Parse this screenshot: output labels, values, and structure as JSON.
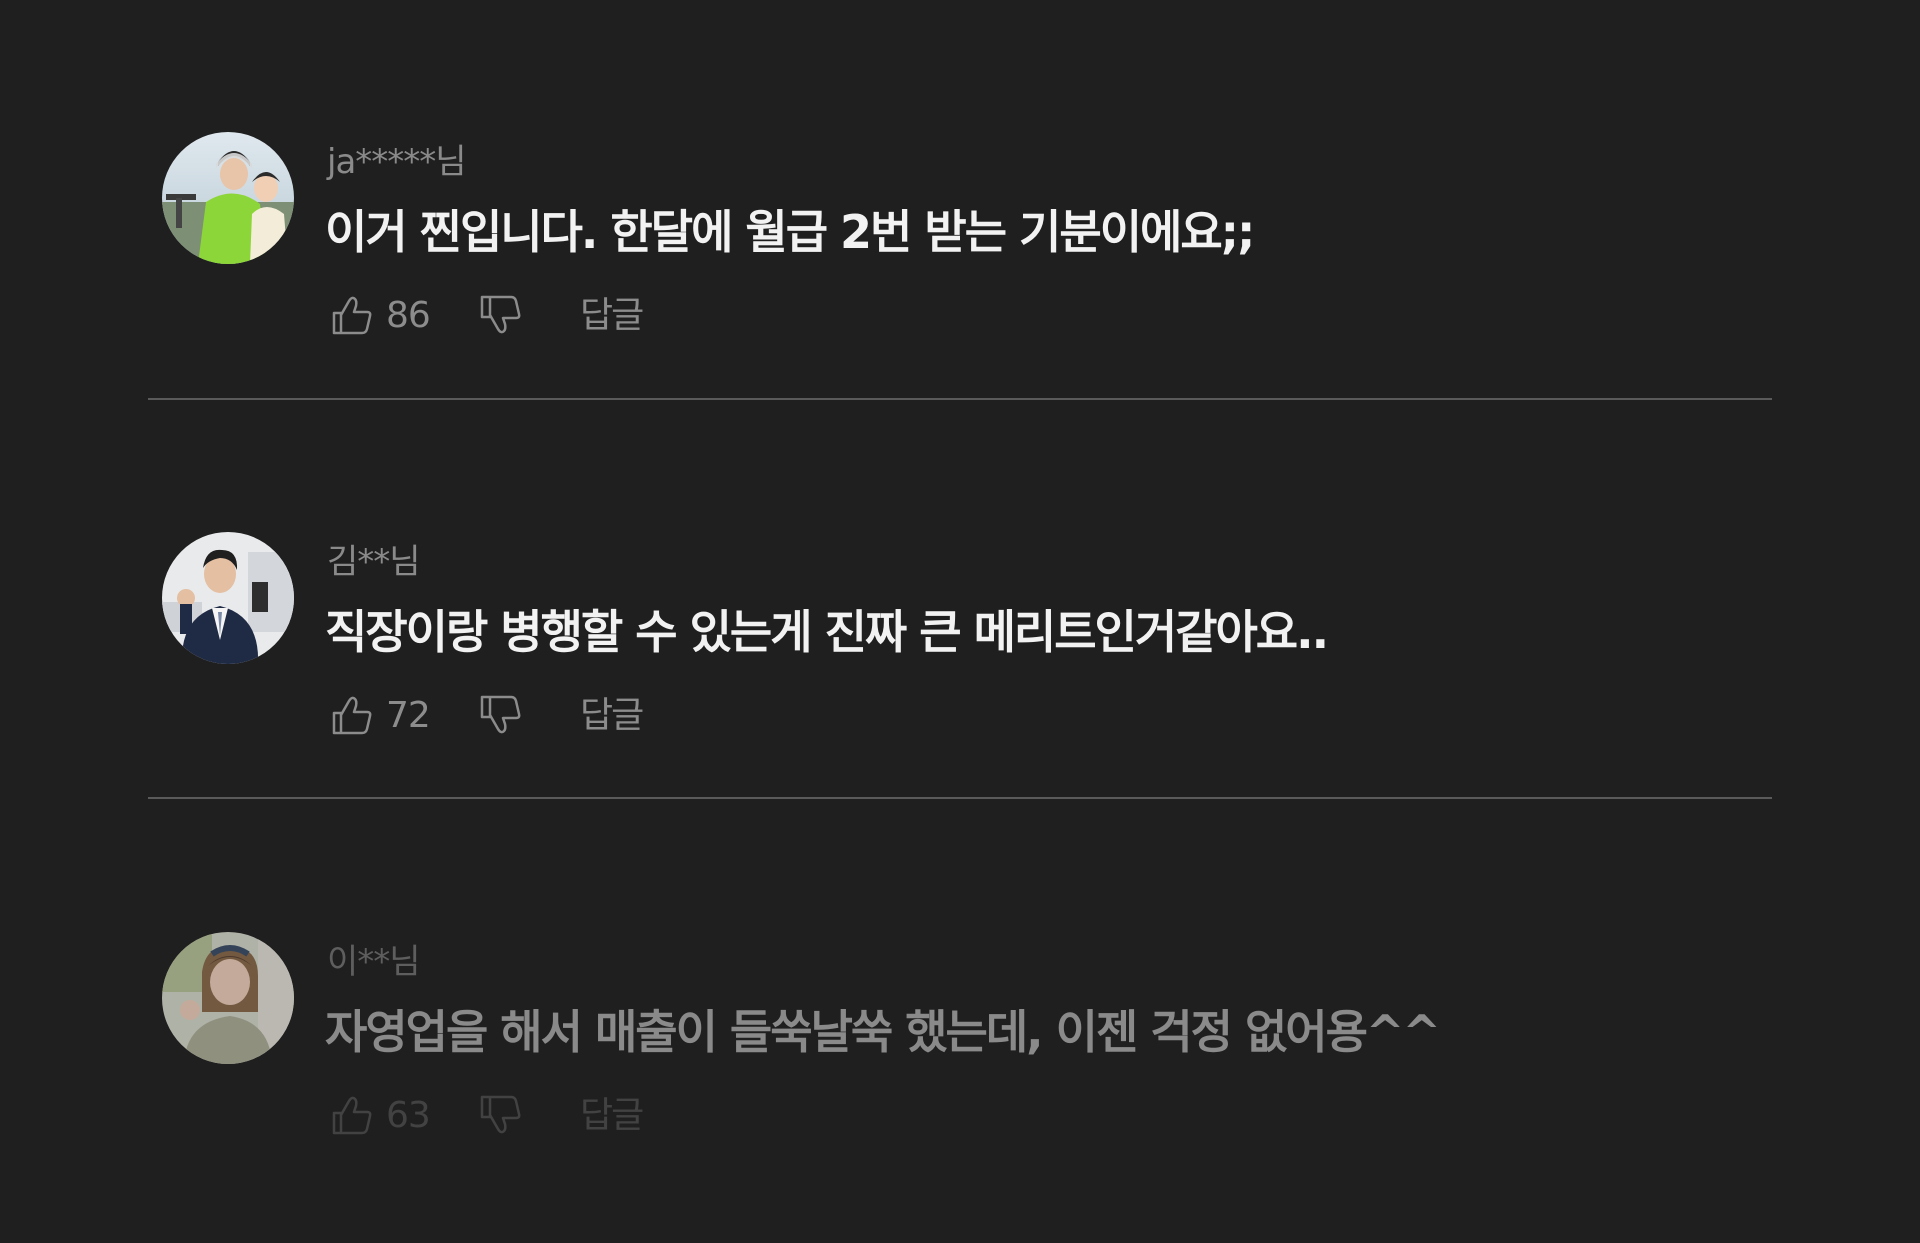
{
  "comments": [
    {
      "user": "ja*****님",
      "text": "이거 찐입니다. 한달에 월급 2번 받는 기분이에요;;",
      "likes": "86",
      "reply_label": "답글",
      "avatar_icon": "couple-on-scooter-photo"
    },
    {
      "user": "김**님",
      "text": "직장이랑 병행할 수 있는게 진짜 큰 메리트인거같아요..",
      "likes": "72",
      "reply_label": "답글",
      "avatar_icon": "man-in-suit-photo"
    },
    {
      "user": "이**님",
      "text": "자영업을 해서 매출이 들쑥날쑥 했는데, 이젠 걱정 없어용^^",
      "likes": "63",
      "reply_label": "답글",
      "avatar_icon": "smiling-woman-photo"
    }
  ],
  "colors": {
    "background": "#1f1f1f",
    "username": "#8a8a8a",
    "comment_text": "#f2f2f2",
    "action": "#8c8c8c",
    "divider": "#5a5a5a"
  }
}
